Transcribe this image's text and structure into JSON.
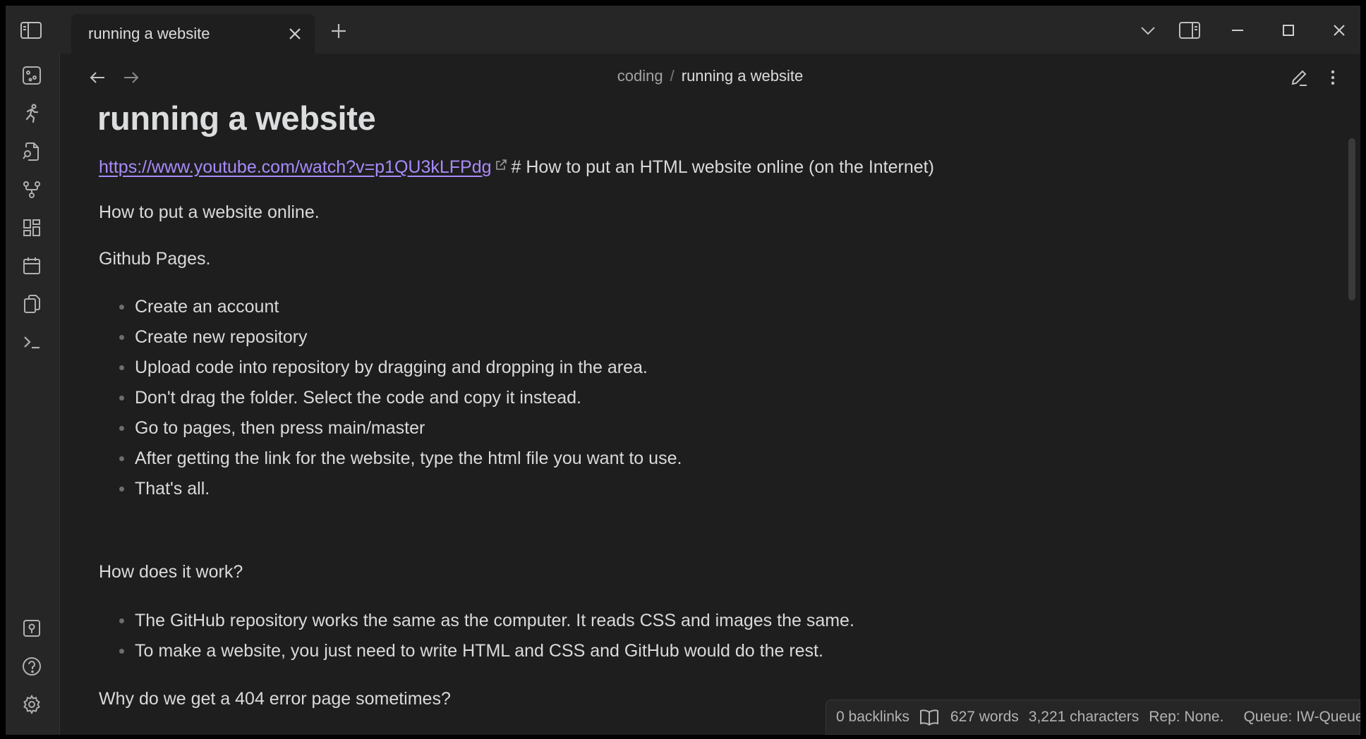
{
  "tab": {
    "title": "running a website"
  },
  "breadcrumb": {
    "parent": "coding",
    "separator": "/",
    "current": "running a website"
  },
  "note": {
    "title": "running a website",
    "link_url_text": "https://www.youtube.com/watch?v=p1QU3kLFPdg",
    "link_trailing": "# How to put an HTML website online (on the Internet)",
    "p1": "How to put a website online.",
    "p2": "Github Pages.",
    "list1": [
      "Create an account",
      "Create new repository",
      "Upload code into repository by dragging and dropping in the area.",
      "Don't drag the folder. Select the code and copy it instead.",
      "Go to pages, then press main/master",
      "After getting the link for the website, type the html file you want to use.",
      "That's all."
    ],
    "p3": "How does it work?",
    "list2": [
      "The GitHub repository works the same as the computer. It reads CSS and images the same.",
      "To make a website, you just need to write HTML and CSS and GitHub would do the rest."
    ],
    "p4": "Why do we get a 404 error page sometimes?"
  },
  "statusbar": {
    "backlinks": "0 backlinks",
    "words": "627 words",
    "characters": "3,221 characters",
    "rep": "Rep: None.",
    "queue": "Queue: IW-Queue"
  },
  "colors": {
    "accent_link": "#a88bfa",
    "background": "#1e1e1e",
    "chrome": "#262626"
  },
  "icons": {
    "ribbon_top": [
      "graph-view-icon",
      "running-man-icon",
      "file-search-icon",
      "git-branch-icon",
      "dashboard-grid-icon",
      "calendar-icon",
      "copy-files-icon",
      "terminal-icon"
    ],
    "ribbon_bottom": [
      "vault-switcher-icon",
      "help-icon",
      "settings-icon"
    ]
  }
}
